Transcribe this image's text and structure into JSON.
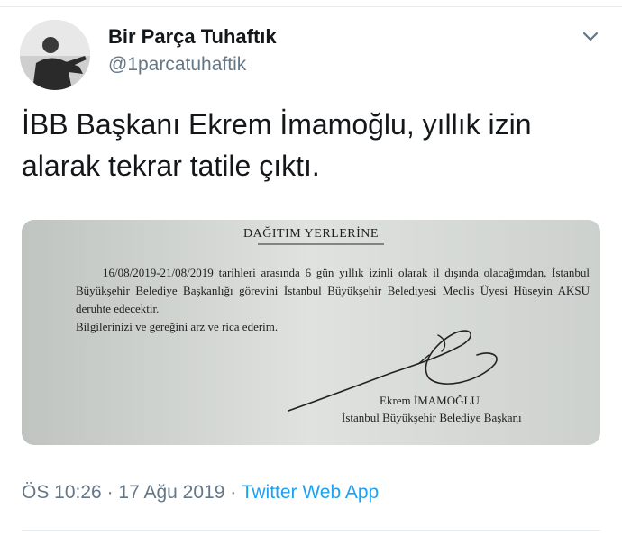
{
  "tweet": {
    "author_name": "Bir Parça Tuhaftık",
    "author_handle": "@1parcatuhaftik",
    "text": "İBB Başkanı Ekrem İmamoğlu, yıllık izin alarak tekrar tatile çıktı.",
    "time": "ÖS 10:26",
    "separator": "·",
    "date": "17 Ağu 2019",
    "source": "Twitter Web App",
    "avatar_icon": "profile-photo",
    "menu_icon": "chevron-down-icon"
  },
  "document": {
    "heading": "DAĞITIM YERLERİNE",
    "body": "16/08/2019-21/08/2019 tarihleri arasında 6 gün yıllık izinli olarak il dışında olacağımdan, İstanbul Büyükşehir Belediye Başkanlığı görevini İstanbul Büyükşehir Belediyesi Meclis Üyesi Hüseyin AKSU deruhte edecektir.",
    "closing": "Bilgilerinizi ve gereğini arz ve rica ederim.",
    "signer_name": "Ekrem İMAMOĞLU",
    "signer_title": "İstanbul Büyükşehir Belediye Başkanı"
  },
  "colors": {
    "link": "#1da1f2",
    "secondary_text": "#657786",
    "primary_text": "#14171a"
  }
}
